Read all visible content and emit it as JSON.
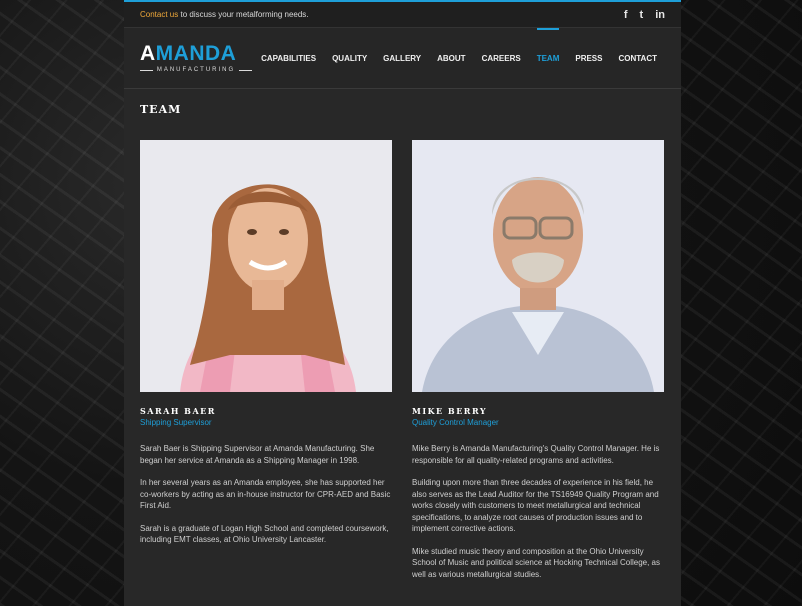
{
  "topbar": {
    "link_text": "Contact us",
    "text": " to discuss your metalforming needs.",
    "social": [
      {
        "icon": "facebook-icon",
        "glyph": "f"
      },
      {
        "icon": "twitter-icon",
        "glyph": "t"
      },
      {
        "icon": "linkedin-icon",
        "glyph": "in"
      }
    ]
  },
  "logo": {
    "main_a": "A",
    "main_rest": "MANDA",
    "sub": "MANUFACTURING"
  },
  "nav": {
    "items": [
      "CAPABILITIES",
      "QUALITY",
      "GALLERY",
      "ABOUT",
      "CAREERS",
      "TEAM",
      "PRESS",
      "CONTACT"
    ],
    "active": "TEAM"
  },
  "page": {
    "title": "TEAM"
  },
  "team": [
    {
      "name": "SARAH BAER",
      "role": "Shipping Supervisor",
      "bio": [
        "Sarah Baer is Shipping Supervisor at Amanda Manufacturing. She began her service at Amanda as a Shipping Manager in 1998.",
        "In her several years as an Amanda employee, she has supported her co-workers by acting as an in-house instructor for CPR-AED and Basic First Aid.",
        "Sarah is a graduate of Logan High School and completed coursework, including EMT classes, at Ohio University Lancaster."
      ]
    },
    {
      "name": "MIKE BERRY",
      "role": "Quality Control Manager",
      "bio": [
        "Mike Berry is Amanda Manufacturing's Quality Control Manager. He is responsible for all quality-related programs and activities.",
        "Building upon more than three decades of experience in his field, he also serves as the Lead Auditor for the TS16949 Quality Program and works closely with customers to meet metallurgical and technical specifications, to analyze root causes of production issues and to implement corrective actions.",
        "Mike studied music theory and composition at the Ohio University School of Music and political science at Hocking Technical College, as well as various metallurgical studies."
      ]
    }
  ],
  "colors": {
    "accent": "#1e9fd8",
    "link": "#f0a93a",
    "panel": "#282828"
  }
}
